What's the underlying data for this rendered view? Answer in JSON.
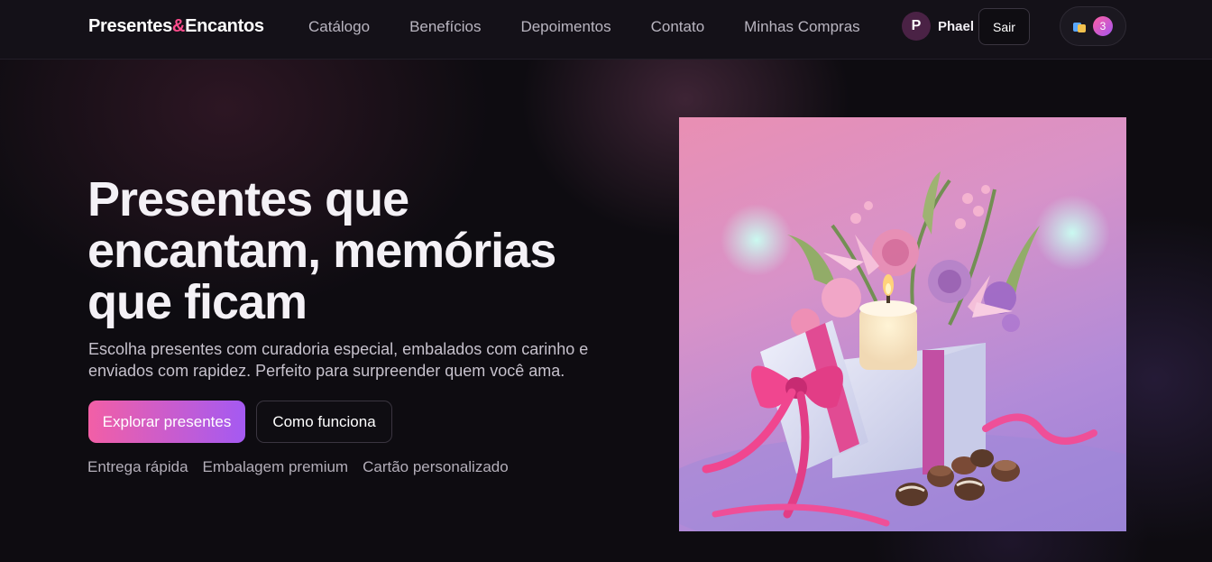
{
  "header": {
    "logo": {
      "part1": "Presentes",
      "amp": "&",
      "part2": "Encantos"
    },
    "nav": [
      {
        "label": "Catálogo"
      },
      {
        "label": "Benefícios"
      },
      {
        "label": "Depoimentos"
      },
      {
        "label": "Contato"
      },
      {
        "label": "Minhas Compras"
      }
    ],
    "user": {
      "initial": "P",
      "name": "Phael"
    },
    "logout_label": "Sair",
    "cart": {
      "icon": "shopping-bag-icon",
      "count": "3"
    }
  },
  "hero": {
    "title": "Presentes que encantam, memórias que ficam",
    "subtitle": "Escolha presentes com curadoria especial, embalados com carinho e enviados com rapidez. Perfeito para surpreender quem você ama.",
    "primary_button": "Explorar presentes",
    "secondary_button": "Como funciona",
    "features": [
      "Entrega rápida",
      "Embalagem premium",
      "Cartão personalizado"
    ]
  },
  "colors": {
    "accent_pink": "#f25fa6",
    "accent_purple": "#a45af2",
    "logo_amp": "#ff4d8d",
    "background": "#0e0c11"
  }
}
